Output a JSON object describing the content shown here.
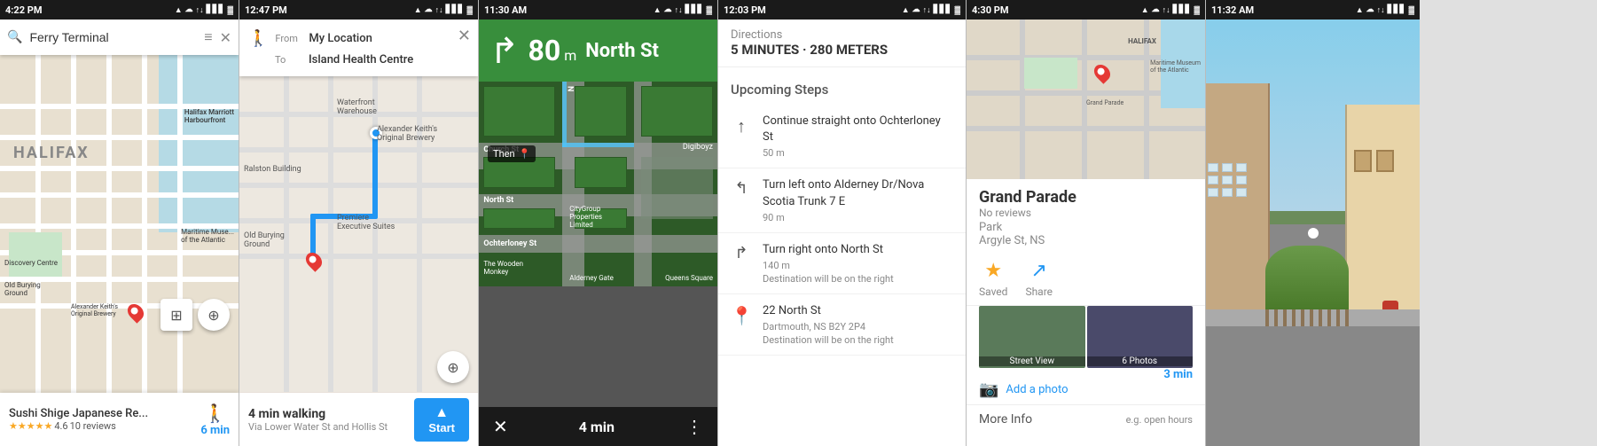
{
  "panels": [
    {
      "id": "panel1",
      "status_bar": {
        "time": "4:22 PM",
        "icons": "▲ ☁ ↑↓ ▋▋▋ 🔋"
      },
      "search": {
        "value": "Ferry Terminal",
        "placeholder": "Search"
      },
      "map": {
        "label": "HALIFAX",
        "location_name": "Halifax"
      },
      "bottom_card": {
        "name": "Sushi Shige Japanese Re...",
        "rating": "4.6",
        "rating_count": "10 reviews",
        "walk_time": "6 min",
        "walk_label": "min"
      }
    },
    {
      "id": "panel2",
      "status_bar": {
        "time": "12:47 PM",
        "icons": "▲ ☁ ↑↓ ▋▋▋ 🔋"
      },
      "route": {
        "from_label": "From",
        "from_value": "My Location",
        "to_label": "To",
        "to_value": "Island Health Centre"
      },
      "bottom": {
        "time": "4 min walking",
        "via": "Via Lower Water St and Hollis St",
        "start_label": "Start"
      }
    },
    {
      "id": "panel3",
      "status_bar": {
        "time": "11:30 AM",
        "icons": "▲ ☁ ↑↓ ▋▋▋ 🔋"
      },
      "nav": {
        "arrow": "↱",
        "distance": "80",
        "unit": "m",
        "street": "North St",
        "then_label": "Then",
        "then_icon": "📍"
      },
      "bottom": {
        "total_time": "4 min"
      }
    },
    {
      "id": "panel4",
      "status_bar": {
        "time": "12:03 PM",
        "icons": "▲ ☁ ↑↓ ▋▋▋ 🔋"
      },
      "directions": {
        "label": "Directions",
        "summary": "5 MINUTES · 280 METERS",
        "upcoming": "Upcoming Steps",
        "steps": [
          {
            "icon": "↑",
            "main": "Continue straight onto Ochterloney St",
            "dist": "50 m"
          },
          {
            "icon": "↲",
            "main": "Turn left onto Alderney Dr/Nova Scotia Trunk 7 E",
            "dist": "90 m"
          },
          {
            "icon": "↳",
            "main": "Turn right onto North St",
            "dist": "140 m",
            "sub": "Destination will be on the right"
          },
          {
            "icon": "📍",
            "main": "22 North St",
            "dist": "Dartmouth, NS B2Y 2P4",
            "sub": "Destination will be on the right"
          }
        ]
      }
    },
    {
      "id": "panel5",
      "status_bar": {
        "time": "4:30 PM",
        "icons": "▲ ☁ ↑↓ ▋▋▋ 🔋"
      },
      "place": {
        "name": "Grand Parade",
        "reviews": "No reviews",
        "type": "Park",
        "address": "Argyle St, NS",
        "walk_time": "3 min",
        "saved_label": "Saved",
        "share_label": "Share",
        "street_view_label": "Street View",
        "photos_label": "6 Photos",
        "add_photo_label": "Add a photo",
        "more_info_label": "More Info",
        "more_info_hint": "e.g. open hours"
      }
    },
    {
      "id": "panel6",
      "status_bar": {
        "time": "11:32 AM",
        "icons": "▲ ☁ ↑↓ ▋▋▋ 🔋"
      }
    }
  ]
}
